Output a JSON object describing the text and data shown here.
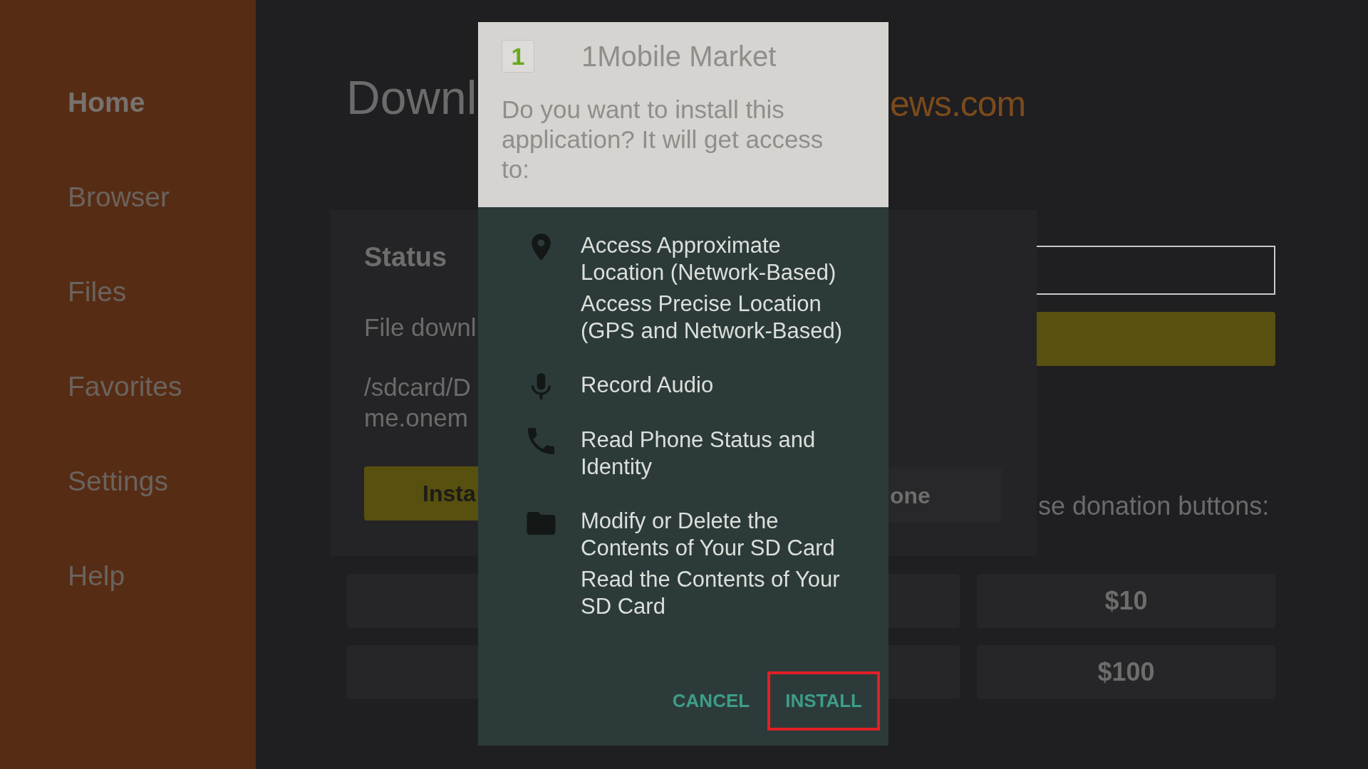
{
  "sidebar": {
    "items": [
      {
        "label": "Home",
        "selected": true
      },
      {
        "label": "Browser",
        "selected": false
      },
      {
        "label": "Files",
        "selected": false
      },
      {
        "label": "Favorites",
        "selected": false
      },
      {
        "label": "Settings",
        "selected": false
      },
      {
        "label": "Help",
        "selected": false
      }
    ]
  },
  "page_title": {
    "left_fragment": "Downl",
    "right_fragment": "ews.com"
  },
  "status_card": {
    "heading": "Status",
    "message": "File downl",
    "path_lines": [
      "/sdcard/D",
      "me.onem"
    ],
    "install_button": "Insta",
    "done_button": "one"
  },
  "donation": {
    "prompt": "se donation buttons:",
    "rows": [
      {
        "amount": "$10"
      },
      {
        "amount": "$100"
      }
    ]
  },
  "dialog": {
    "app_logo": "1",
    "title": "1Mobile Market",
    "message": "Do you want to install this application? It will get access to:",
    "permission_groups": [
      {
        "kind": "location",
        "permissions": [
          "Access Approximate Location (Network-Based)",
          "Access Precise Location (GPS and Network-Based)"
        ]
      },
      {
        "kind": "audio",
        "permissions": [
          "Record Audio"
        ]
      },
      {
        "kind": "phone",
        "permissions": [
          "Read Phone Status and Identity"
        ]
      },
      {
        "kind": "storage",
        "permissions": [
          "Modify or Delete the Contents of Your SD Card",
          "Read the Contents of Your SD Card"
        ]
      }
    ],
    "buttons": [
      {
        "label": "CANCEL",
        "highlighted": false
      },
      {
        "label": "INSTALL",
        "highlighted": true
      }
    ]
  }
}
